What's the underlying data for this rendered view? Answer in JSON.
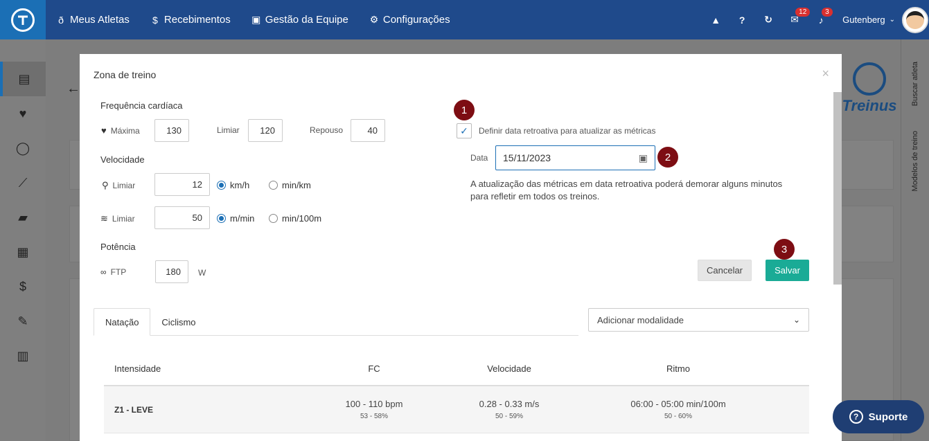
{
  "topbar": {
    "nav": [
      {
        "label": "Meus Atletas",
        "icon": "medal-icon",
        "glyph": "ð"
      },
      {
        "label": "Recebimentos",
        "icon": "dollar-icon",
        "glyph": "$"
      },
      {
        "label": "Gestão da Equipe",
        "icon": "id-card-icon",
        "glyph": "▣"
      },
      {
        "label": "Configurações",
        "icon": "gears-icon",
        "glyph": "⚙"
      }
    ],
    "messages_count": "12",
    "notifications_count": "3",
    "user_name": "Gutenberg"
  },
  "modal": {
    "title": "Zona de treino",
    "brand": "Treinus",
    "heart_rate": {
      "section": "Frequência cardíaca",
      "max_label": "Máxima",
      "max_value": "130",
      "threshold_label": "Limiar",
      "threshold_value": "120",
      "rest_label": "Repouso",
      "rest_value": "40"
    },
    "speed": {
      "section": "Velocidade",
      "run_label": "Limiar",
      "run_value": "12",
      "run_unit_a": "km/h",
      "run_unit_b": "min/km",
      "swim_label": "Limiar",
      "swim_value": "50",
      "swim_unit_a": "m/min",
      "swim_unit_b": "min/100m"
    },
    "power": {
      "section": "Potência",
      "ftp_label": "FTP",
      "ftp_value": "180",
      "ftp_unit": "W"
    },
    "retro": {
      "checkbox_label": "Definir data retroativa para atualizar as métricas",
      "date_label": "Data",
      "date_value": "15/11/2023",
      "info_line1": "A atualização das métricas em data retroativa poderá demorar alguns minutos",
      "info_line2": "para refletir em todos os treinos."
    },
    "steps": [
      "1",
      "2",
      "3"
    ],
    "cancel_label": "Cancelar",
    "save_label": "Salvar",
    "tabs": [
      "Natação",
      "Ciclismo"
    ],
    "add_modality": "Adicionar modalidade",
    "table": {
      "headers": [
        "Intensidade",
        "FC",
        "Velocidade",
        "Ritmo"
      ],
      "rows": [
        {
          "intensity": "Z1 - LEVE",
          "fc": "100 - 110 bpm",
          "fc_pct": "53 - 58%",
          "speed": "0.28 - 0.33 m/s",
          "speed_pct": "50 - 59%",
          "pace": "06:00 - 05:00 min/100m",
          "pace_pct": "50 - 60%"
        }
      ]
    }
  },
  "right_rail": {
    "search_athlete": "Buscar atleta",
    "workout_models": "Modelos de treino"
  },
  "support_label": "Suporte"
}
